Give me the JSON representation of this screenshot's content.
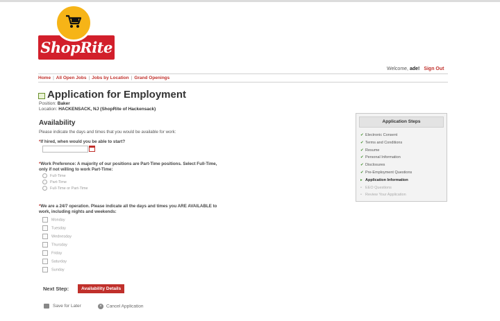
{
  "header": {
    "logo_text": "ShopRite",
    "welcome_prefix": "Welcome,",
    "user": "ade!",
    "sign_out": "Sign Out"
  },
  "nav": [
    "Home",
    "All Open Jobs",
    "Jobs by Location",
    "Grand Openings"
  ],
  "page": {
    "title": "Application for Employment",
    "position_label": "Position:",
    "position": "Baker",
    "location_label": "Location:",
    "location": "HACKENSACK, NJ  (ShopRite of Hackensack)"
  },
  "availability": {
    "section_title": "Availability",
    "intro": "Please indicate the days and times that you would be available for work:",
    "q1": "If hired, when would you be able to start?",
    "q2_line1": "Work Preference: A majority of our positions are Part-Time positions. Select Full-Time,",
    "q2_line2": "only if not willing to work Part-Time:",
    "options": [
      "Full-Time",
      "Part-Time",
      "Full-Time or Part-Time"
    ],
    "q3_line1": "We are a 24/7 operation. Please indicate all the days and times you ARE AVAILABLE to",
    "q3_line2": "work, including nights and weekends:",
    "days": [
      "Monday",
      "Tuesday",
      "Wednesday",
      "Thursday",
      "Friday",
      "Saturday",
      "Sunday"
    ]
  },
  "footer": {
    "next_step_label": "Next Step:",
    "next_button": "Availability Details",
    "save_for_later": "Save for Later",
    "cancel_application": "Cancel Application"
  },
  "steps": {
    "title": "Application Steps",
    "completed": [
      "Electronic Consent",
      "Terms and Conditions",
      "Resume",
      "Personal Information",
      "Disclosures",
      "Pre-Employment Questions"
    ],
    "current": "Application Information",
    "pending": [
      "EEO Questions",
      "Review Your Application"
    ]
  },
  "colors": {
    "brand_red": "#c0302b",
    "logo_yellow": "#f6b417",
    "check_green": "#3f8f2a"
  }
}
